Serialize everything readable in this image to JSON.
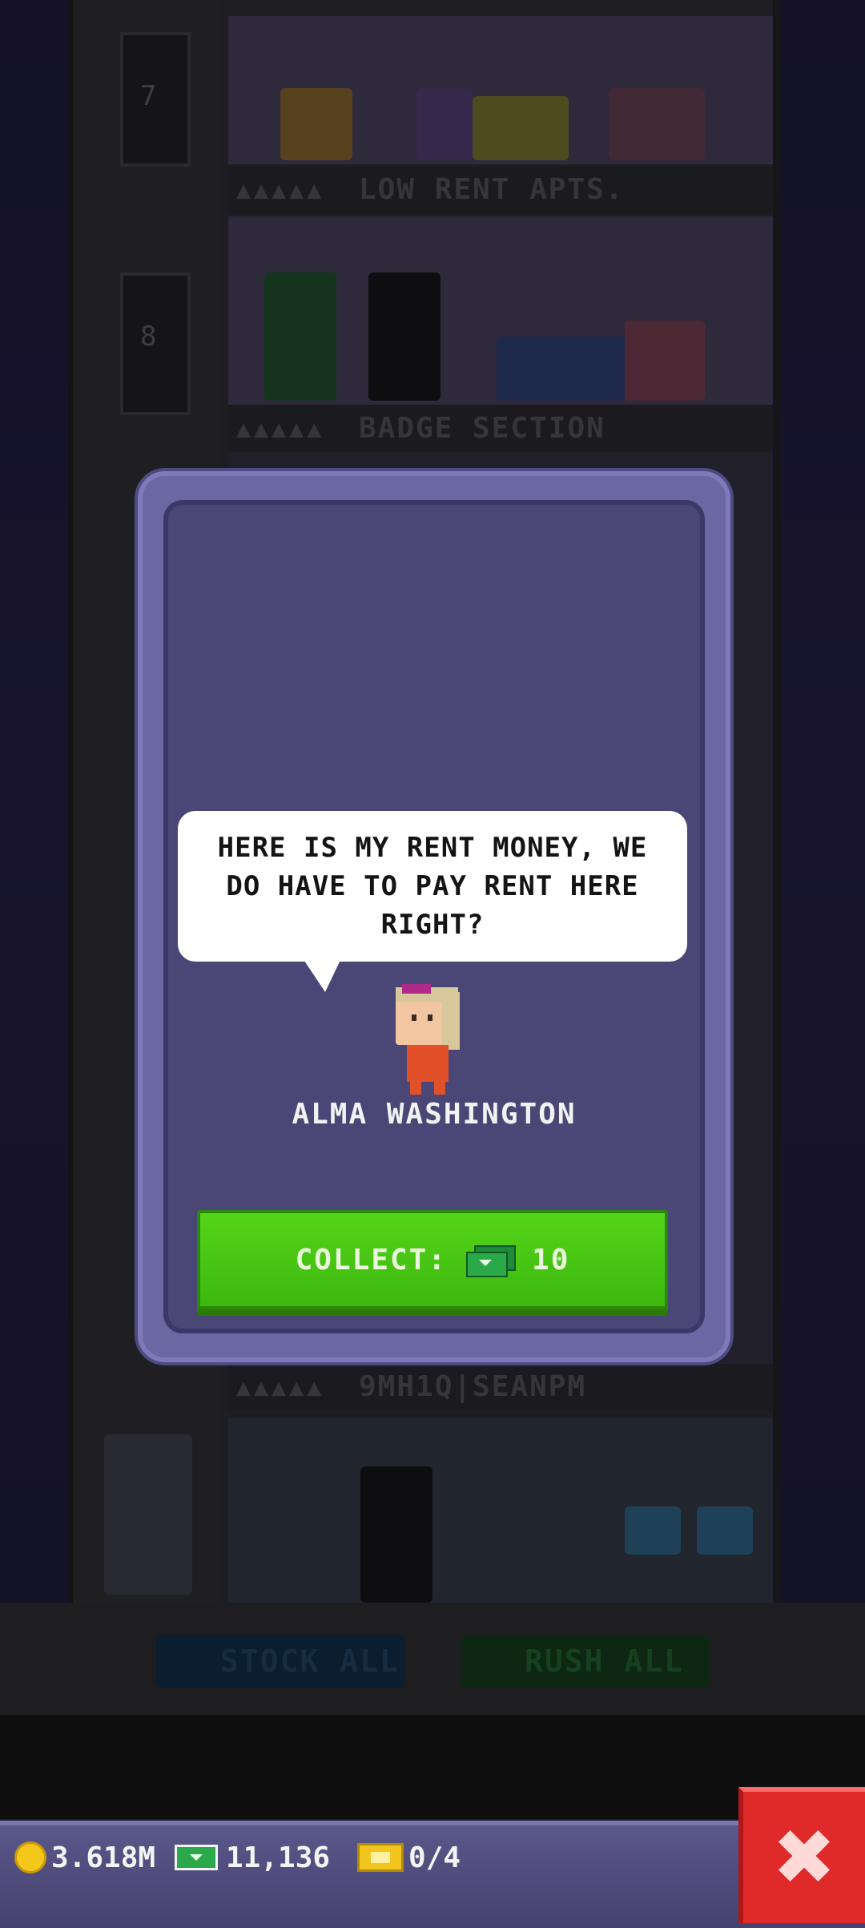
{
  "tower": {
    "floors": [
      {
        "number": "7",
        "name": "LOW RENT APTS.",
        "stars": "▲▲▲▲▲"
      },
      {
        "number": "8",
        "name": "BADGE SECTION",
        "stars": "▲▲▲▲▲"
      },
      {
        "number": "",
        "name": "9MH1Q|SEANPM",
        "stars": "▲▲▲▲▲"
      }
    ],
    "actions": {
      "stock_all_label": "STOCK ALL",
      "rush_all_label": "RUSH ALL"
    }
  },
  "dialog": {
    "speech": "HERE IS MY RENT MONEY, WE DO HAVE TO PAY RENT HERE RIGHT?",
    "resident_name": "ALMA WASHINGTON",
    "collect_label": "COLLECT:",
    "collect_amount": "10"
  },
  "status_bar": {
    "coins": "3.618M",
    "bux": "11,136",
    "tickets": "0/4"
  },
  "colors": {
    "dialog_bg": "#4a4777",
    "collect_green": "#4cc814",
    "close_red": "#e02a2a"
  }
}
